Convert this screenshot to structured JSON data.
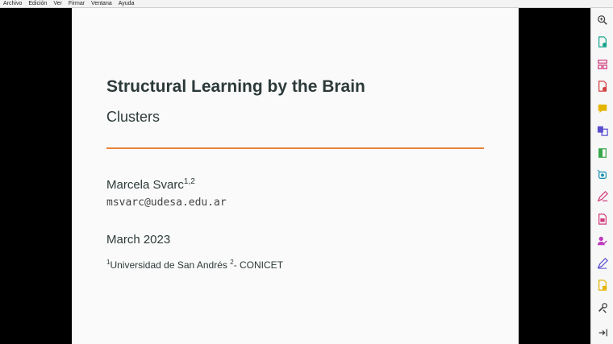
{
  "menu": [
    "Archivo",
    "Edición",
    "Ver",
    "Firmar",
    "Ventana",
    "Ayuda"
  ],
  "slide": {
    "title": "Structural Learning by the Brain",
    "subtitle": "Clusters",
    "author": "Marcela Svarc",
    "author_sup": "1,2",
    "email": "msvarc@udesa.edu.ar",
    "date": "March 2023",
    "affil_1_sup": "1",
    "affil_1": "Universidad de San Andrés",
    "affil_2_sup": "2",
    "affil_2": "- CONICET",
    "rule_color": "#e8823a"
  },
  "tools": [
    {
      "name": "zoom-icon",
      "color": "#444444"
    },
    {
      "name": "create-pdf-icon",
      "color": "#1aa58c"
    },
    {
      "name": "organize-pages-icon",
      "color": "#d23a7b"
    },
    {
      "name": "export-pdf-icon",
      "color": "#d43f3f"
    },
    {
      "name": "comment-icon",
      "color": "#e3b400"
    },
    {
      "name": "combine-files-icon",
      "color": "#5a4fcf"
    },
    {
      "name": "compress-pdf-icon",
      "color": "#38a84a"
    },
    {
      "name": "scan-icon",
      "color": "#1a8fb0"
    },
    {
      "name": "fill-sign-icon",
      "color": "#d23a7b"
    },
    {
      "name": "edit-pdf-icon",
      "color": "#d23a7b"
    },
    {
      "name": "request-signature-icon",
      "color": "#c03ac0"
    },
    {
      "name": "sign-pen-icon",
      "color": "#5a4fcf"
    },
    {
      "name": "protect-icon",
      "color": "#e3b400"
    },
    {
      "name": "more-tools-icon",
      "color": "#444444"
    },
    {
      "name": "collapse-panel-icon",
      "color": "#444444"
    }
  ]
}
